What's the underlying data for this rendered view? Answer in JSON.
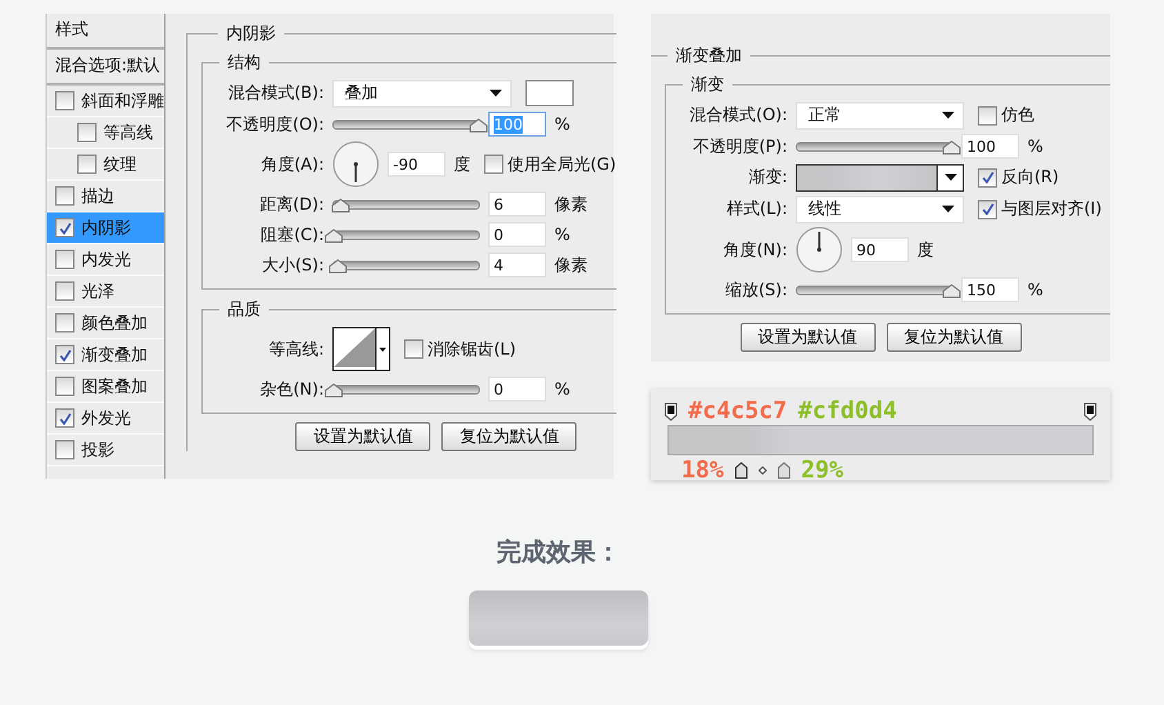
{
  "styles_panel": {
    "header": "样式",
    "blend_options": "混合选项:默认",
    "items": [
      {
        "label": "斜面和浮雕",
        "checked": false,
        "selected": false,
        "children": [
          {
            "label": "等高线",
            "checked": false,
            "selected": false
          },
          {
            "label": "纹理",
            "checked": false,
            "selected": false
          }
        ]
      },
      {
        "label": "描边",
        "checked": false,
        "selected": false
      },
      {
        "label": "内阴影",
        "checked": true,
        "selected": true
      },
      {
        "label": "内发光",
        "checked": false,
        "selected": false
      },
      {
        "label": "光泽",
        "checked": false,
        "selected": false
      },
      {
        "label": "颜色叠加",
        "checked": false,
        "selected": false
      },
      {
        "label": "渐变叠加",
        "checked": true,
        "selected": false
      },
      {
        "label": "图案叠加",
        "checked": false,
        "selected": false
      },
      {
        "label": "外发光",
        "checked": true,
        "selected": false
      },
      {
        "label": "投影",
        "checked": false,
        "selected": false
      }
    ]
  },
  "inner_shadow": {
    "title": "内阴影",
    "structure": {
      "title": "结构",
      "rows": [
        {
          "kind": "select",
          "label": "混合模式(B):",
          "value": "叠加",
          "swatch": true
        },
        {
          "kind": "slider",
          "label": "不透明度(O):",
          "level": 1,
          "value": "100",
          "unit": "%",
          "focused": true
        },
        {
          "kind": "angle",
          "label": "角度(A):",
          "value": "-90",
          "unit": "度",
          "checkbox": {
            "label": "使用全局光(G)",
            "checked": false
          }
        },
        {
          "kind": "slider",
          "label": "距离(D):",
          "level": 0.05,
          "value": "6",
          "unit": "像素",
          "focused": false
        },
        {
          "kind": "slider",
          "label": "阻塞(C):",
          "level": 0,
          "value": "0",
          "unit": "%",
          "focused": false
        },
        {
          "kind": "slider",
          "label": "大小(S):",
          "level": 0.03,
          "value": "4",
          "unit": "像素",
          "focused": false
        }
      ]
    },
    "quality": {
      "title": "品质",
      "rows": [
        {
          "kind": "contour",
          "label": "等高线:",
          "checkbox": {
            "label": "消除锯齿(L)",
            "checked": false
          }
        },
        {
          "kind": "slider",
          "label": "杂色(N):",
          "level": 0,
          "value": "0",
          "unit": "%",
          "focused": false
        }
      ]
    },
    "buttons": [
      "设置为默认值",
      "复位为默认值"
    ]
  },
  "gradient_overlay": {
    "title": "渐变叠加",
    "section": {
      "title": "渐变",
      "rows": [
        {
          "kind": "select",
          "label": "混合模式(O):",
          "value": "正常",
          "checkbox": {
            "label": "仿色",
            "checked": false
          }
        },
        {
          "kind": "slider",
          "label": "不透明度(P):",
          "level": 1,
          "value": "100",
          "unit": "%",
          "focused": false
        },
        {
          "kind": "gradient",
          "label": "渐变:",
          "checkbox": {
            "label": "反向(R)",
            "checked": true
          }
        },
        {
          "kind": "select",
          "label": "样式(L):",
          "value": "线性",
          "checkbox": {
            "label": "与图层对齐(I)",
            "checked": true
          }
        },
        {
          "kind": "angle",
          "label": "角度(N):",
          "value": "90",
          "unit": "度"
        },
        {
          "kind": "slider",
          "label": "缩放(S):",
          "level": 1,
          "value": "150",
          "unit": "%",
          "focused": false
        }
      ]
    },
    "buttons": [
      "设置为默认值",
      "复位为默认值"
    ]
  },
  "gradient_editor": {
    "colors": [
      {
        "text": "#c4c5c7",
        "color": "#f26b4b"
      },
      {
        "text": "#cfd0d4",
        "color": "#8cbf2a"
      }
    ],
    "locations": [
      {
        "text": "18%",
        "color": "#f26b4b"
      },
      {
        "text": "29%",
        "color": "#8cbf2a"
      }
    ]
  },
  "result": {
    "label": "完成效果："
  }
}
